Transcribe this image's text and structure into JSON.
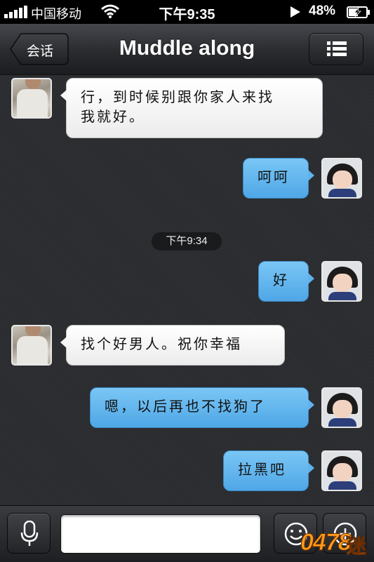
{
  "status_bar": {
    "carrier": "中国移动",
    "time": "下午9:35",
    "battery": "48%"
  },
  "nav": {
    "back_label": "会话",
    "title": "Muddle along"
  },
  "messages": [
    {
      "side": "left",
      "text_line1": "行，到时候别跟你家人来找",
      "text_line2": "我就好。"
    },
    {
      "side": "right",
      "text": "呵呵"
    },
    {
      "timestamp": "下午9:34"
    },
    {
      "side": "right",
      "text": "好"
    },
    {
      "side": "left",
      "text": "找个好男人。祝你幸福"
    },
    {
      "side": "right",
      "text": "嗯，以后再也不找狗了"
    },
    {
      "side": "right",
      "text": "拉黑吧"
    }
  ],
  "input": {
    "value": "",
    "placeholder": ""
  },
  "watermark": {
    "text": "0478",
    "char": "迷"
  },
  "colors": {
    "incoming_bubble": "#ffffff",
    "outgoing_bubble": "#5fb3ec",
    "background": "#2b2c2f"
  }
}
